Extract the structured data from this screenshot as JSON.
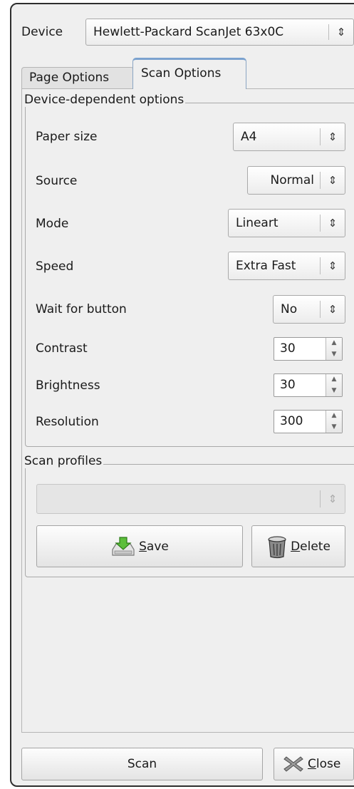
{
  "device": {
    "label": "Device",
    "selected": "Hewlett-Packard ScanJet 63x0C"
  },
  "tabs": [
    {
      "label": "Page Options",
      "active": false
    },
    {
      "label": "Scan Options",
      "active": true
    }
  ],
  "device_options": {
    "title": "Device-dependent options",
    "paper_size": {
      "label": "Paper size",
      "value": "A4"
    },
    "source": {
      "label": "Source",
      "value": "Normal"
    },
    "mode": {
      "label": "Mode",
      "value": "Lineart"
    },
    "speed": {
      "label": "Speed",
      "value": "Extra Fast"
    },
    "wait_for_button": {
      "label": "Wait for button",
      "value": "No"
    },
    "contrast": {
      "label": "Contrast",
      "value": "30"
    },
    "brightness": {
      "label": "Brightness",
      "value": "30"
    },
    "resolution": {
      "label": "Resolution",
      "value": "300"
    }
  },
  "profiles": {
    "title": "Scan profiles",
    "selected": "",
    "save": {
      "mnemonic": "S",
      "rest": "ave"
    },
    "delete": {
      "mnemonic": "D",
      "rest": "elete"
    }
  },
  "footer": {
    "scan_label": "Scan",
    "close": {
      "mnemonic": "C",
      "rest": "lose"
    }
  },
  "icons": {
    "combo_arrow": "updown-arrows-icon",
    "save": "save-disk-icon",
    "delete": "trash-can-icon",
    "close": "close-x-icon"
  }
}
